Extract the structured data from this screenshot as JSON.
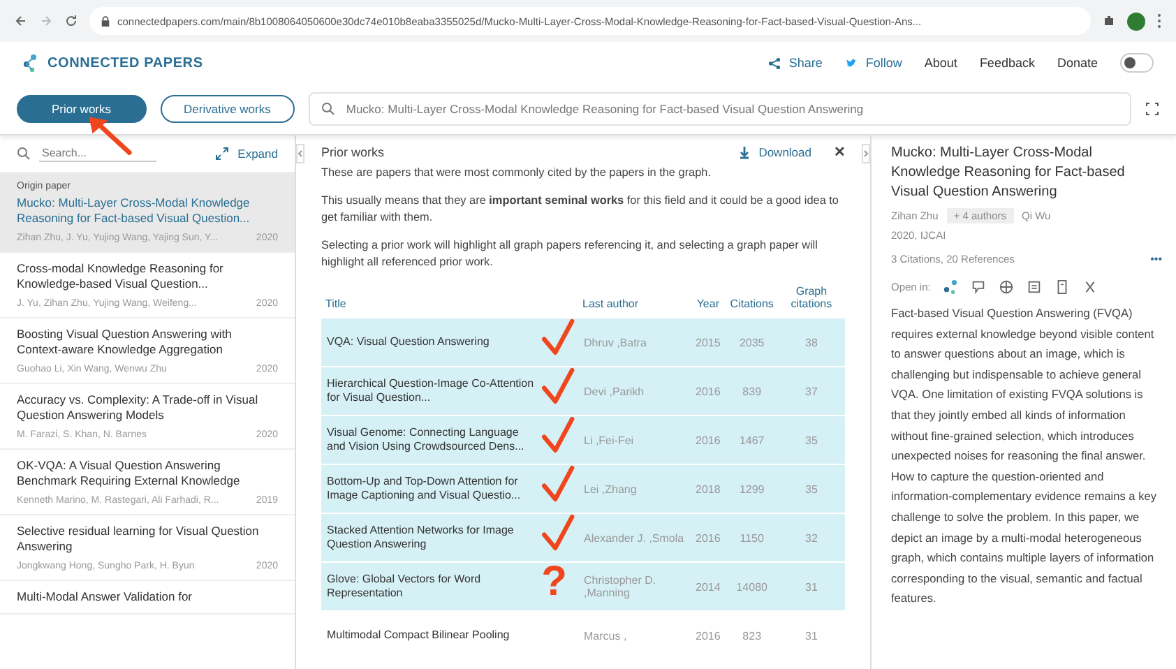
{
  "browser": {
    "url": "connectedpapers.com/main/8b1008064050600e30dc74e010b8eaba3355025d/Mucko-Multi-Layer-Cross-Modal-Knowledge-Reasoning-for-Fact-based-Visual-Question-Ans..."
  },
  "header": {
    "logo": "CONNECTED PAPERS",
    "links": [
      {
        "kind": "share",
        "label": "Share"
      },
      {
        "kind": "twitter",
        "label": "Follow"
      },
      {
        "kind": "plain",
        "label": "About"
      },
      {
        "kind": "plain",
        "label": "Feedback"
      },
      {
        "kind": "plain",
        "label": "Donate"
      }
    ],
    "dark_mode": false
  },
  "toolbar": {
    "tabs": [
      {
        "label": "Prior works",
        "selected": true,
        "arrow": true
      },
      {
        "label": "Derivative works",
        "selected": false
      }
    ],
    "search": {
      "value": "Mucko: Multi-Layer Cross-Modal Knowledge Reasoning for Fact-based Visual Question Answering"
    }
  },
  "sidebar": {
    "search": {
      "placeholder": "Search..."
    },
    "expand": "Expand",
    "items": [
      {
        "label": "Origin paper",
        "title": "Mucko: Multi-Layer Cross-Modal Knowledge Reasoning for Fact-based Visual Question...",
        "authors": "Zihan Zhu, J. Yu, Yujing Wang, Yajing Sun, Y...",
        "year": "2020",
        "selected": true
      },
      {
        "title": "Cross-modal Knowledge Reasoning for Knowledge-based Visual Question...",
        "authors": "J. Yu, Zihan Zhu, Yujing Wang, Weifeng...",
        "year": "2020",
        "selected": false
      },
      {
        "title": "Boosting Visual Question Answering with Context-aware Knowledge Aggregation",
        "authors": "Guohao Li, Xin Wang, Wenwu Zhu",
        "year": "2020",
        "selected": false
      },
      {
        "title": "Accuracy vs. Complexity: A Trade-off in Visual Question Answering Models",
        "authors": "M. Farazi, S. Khan, N. Barnes",
        "year": "2020",
        "selected": false
      },
      {
        "title": "OK-VQA: A Visual Question Answering Benchmark Requiring External Knowledge",
        "authors": "Kenneth Marino, M. Rastegari, Ali Farhadi, R...",
        "year": "2019",
        "selected": false
      },
      {
        "title": "Selective residual learning for Visual Question Answering",
        "authors": "Jongkwang Hong, Sungho Park, H. Byun",
        "year": "2020",
        "selected": false
      },
      {
        "title": "Multi-Modal Answer Validation for",
        "selected": false
      }
    ]
  },
  "prior_works": {
    "title": "Prior works",
    "download": "Download",
    "close": "✕",
    "paragraphs": [
      "These are papers that were most commonly cited by the papers in the graph.",
      "This usually means that they are **important seminal works** for this field and it could be a good idea to get familiar with them.",
      "Selecting a prior work will highlight all graph papers referencing it, and selecting a graph paper will highlight all referenced prior work."
    ],
    "table": {
      "columns": [
        "Title",
        "Last author",
        "Year",
        "Citations",
        "Graph citations"
      ],
      "rows": [
        {
          "title": "VQA: Visual Question Answering",
          "author": "Dhruv ,Batra",
          "year": "2015",
          "citations": "2035",
          "graph_citations": "38",
          "highlighted": true,
          "annotation": {
            "kind": "check"
          }
        },
        {
          "title": "Hierarchical Question-Image Co-Attention for Visual Question...",
          "author": "Devi ,Parikh",
          "year": "2016",
          "citations": "839",
          "graph_citations": "37",
          "highlighted": true,
          "annotation": {
            "kind": "check"
          }
        },
        {
          "title": "Visual Genome: Connecting Language and Vision Using Crowdsourced Dens...",
          "author": "Li ,Fei-Fei",
          "year": "2016",
          "citations": "1467",
          "graph_citations": "35",
          "highlighted": true,
          "annotation": {
            "kind": "check"
          }
        },
        {
          "title": "Bottom-Up and Top-Down Attention for Image Captioning and Visual Questio...",
          "author": "Lei ,Zhang",
          "year": "2018",
          "citations": "1299",
          "graph_citations": "35",
          "highlighted": true,
          "annotation": {
            "kind": "check"
          }
        },
        {
          "title": "Stacked Attention Networks for Image Question Answering",
          "author": "Alexander J. ,Smola",
          "year": "2016",
          "citations": "1150",
          "graph_citations": "32",
          "highlighted": true,
          "annotation": {
            "kind": "check"
          }
        },
        {
          "title": "Glove: Global Vectors for Word Representation",
          "author": "Christopher D. ,Manning",
          "year": "2014",
          "citations": "14080",
          "graph_citations": "31",
          "highlighted": true,
          "annotation": {
            "kind": "question",
            "text": "?"
          }
        },
        {
          "title": "Multimodal Compact Bilinear Pooling",
          "author": "Marcus ,",
          "year": "2016",
          "citations": "823",
          "graph_citations": "31",
          "highlighted": false
        }
      ]
    }
  },
  "details": {
    "title": "Mucko: Multi-Layer Cross-Modal Knowledge Reasoning for Fact-based Visual Question Answering",
    "first_author": "Zihan Zhu",
    "more_authors": "+ 4 authors",
    "last_author": "Qi Wu",
    "venue": "2020, IJCAI",
    "counts": "3 Citations, 20 References",
    "more": "•••",
    "open_in": "Open in:",
    "abstract": "Fact-based Visual Question Answering (FVQA) requires external knowledge beyond visible content to answer questions about an image, which is challenging but indispensable to achieve general VQA. One limitation of existing FVQA solutions is that they jointly embed all kinds of information without fine-grained selection, which introduces unexpected noises for reasoning the final answer. How to capture the question-oriented and information-complementary evidence remains a key challenge to solve the problem. In this paper, we depict an image by a multi-modal heterogeneous graph, which contains multiple layers of information corresponding to the visual, semantic and factual features."
  }
}
